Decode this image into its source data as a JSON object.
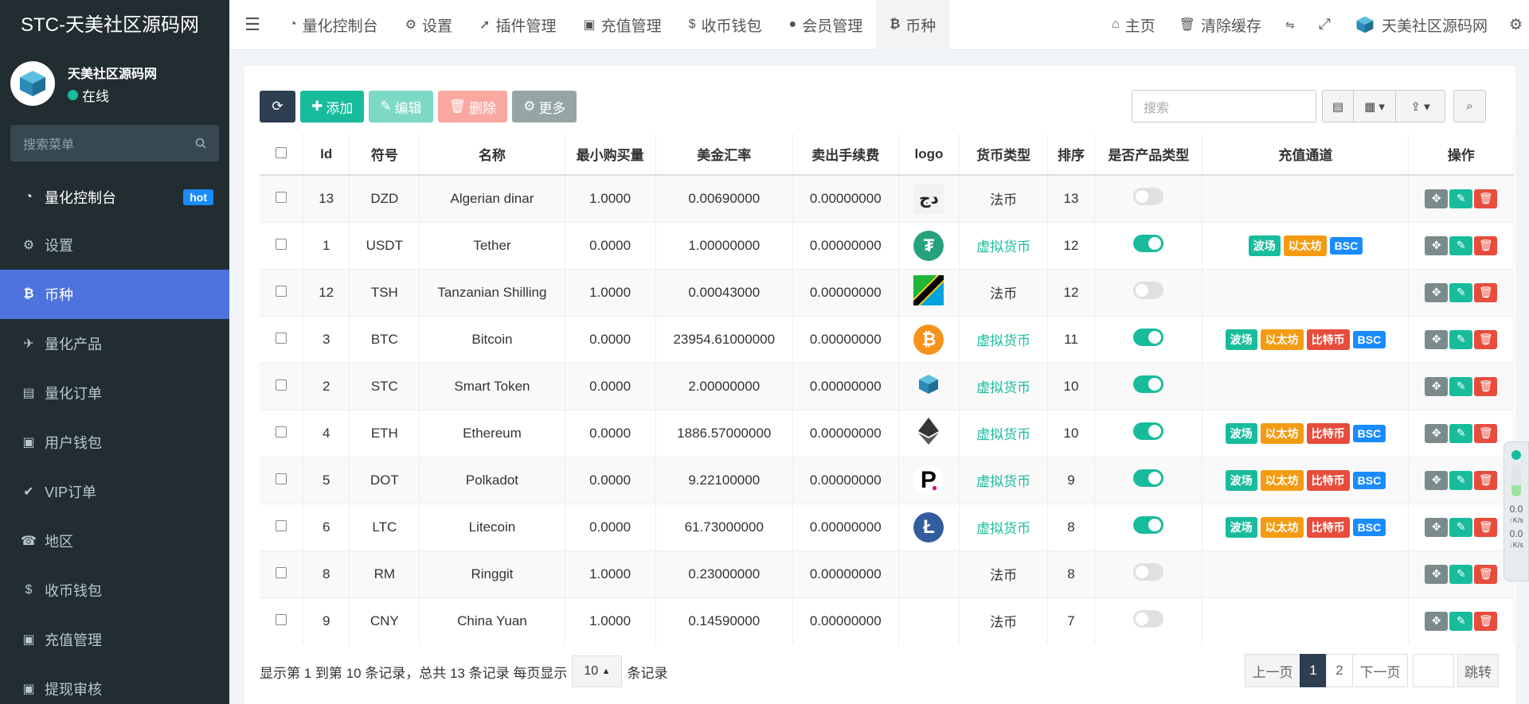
{
  "app": {
    "title": "STC-天美社区源码网"
  },
  "user": {
    "name": "天美社区源码网",
    "status": "在线"
  },
  "sidebar": {
    "search_placeholder": "搜索菜单",
    "items": [
      {
        "label": "量化控制台",
        "badge": "hot",
        "icon": "dashboard-icon"
      },
      {
        "label": "设置",
        "icon": "gear-icon"
      },
      {
        "label": "币种",
        "icon": "bitcoin-icon"
      },
      {
        "label": "量化产品",
        "icon": "plane-icon"
      },
      {
        "label": "量化订单",
        "icon": "book-icon"
      },
      {
        "label": "用户钱包",
        "icon": "money-icon"
      },
      {
        "label": "VIP订单",
        "icon": "check-circle-icon"
      },
      {
        "label": "地区",
        "icon": "phone-icon"
      },
      {
        "label": "收币钱包",
        "icon": "dollar-icon"
      },
      {
        "label": "充值管理",
        "icon": "money-icon"
      },
      {
        "label": "提现审核",
        "icon": "money-icon"
      }
    ]
  },
  "topbar": {
    "tabs": [
      {
        "label": "量化控制台",
        "icon": "dashboard-icon"
      },
      {
        "label": "设置",
        "icon": "gear-icon"
      },
      {
        "label": "插件管理",
        "icon": "rocket-icon"
      },
      {
        "label": "充值管理",
        "icon": "money-icon"
      },
      {
        "label": "收币钱包",
        "icon": "dollar-icon"
      },
      {
        "label": "会员管理",
        "icon": "user-icon"
      },
      {
        "label": "币种",
        "icon": "bitcoin-icon"
      }
    ],
    "home": "主页",
    "clear_cache": "清除缓存",
    "site_name": "天美社区源码网"
  },
  "toolbar": {
    "add": "添加",
    "edit": "编辑",
    "delete": "删除",
    "more": "更多",
    "search_placeholder": "搜索"
  },
  "table": {
    "headers": [
      "Id",
      "符号",
      "名称",
      "最小购买量",
      "美金汇率",
      "卖出手续费",
      "logo",
      "货币类型",
      "排序",
      "是否产品类型",
      "充值通道",
      "操作"
    ],
    "rows": [
      {
        "id": "13",
        "symbol": "DZD",
        "name": "Algerian dinar",
        "min": "1.0000",
        "rate": "0.00690000",
        "fee": "0.00000000",
        "logo": "dzd",
        "type": "法币",
        "sort": "13",
        "product": false,
        "channels": []
      },
      {
        "id": "1",
        "symbol": "USDT",
        "name": "Tether",
        "min": "0.0000",
        "rate": "1.00000000",
        "fee": "0.00000000",
        "logo": "usdt",
        "type": "虚拟货币",
        "sort": "12",
        "product": true,
        "channels": [
          "波场",
          "以太坊",
          "BSC"
        ]
      },
      {
        "id": "12",
        "symbol": "TSH",
        "name": "Tanzanian Shilling",
        "min": "1.0000",
        "rate": "0.00043000",
        "fee": "0.00000000",
        "logo": "tsh",
        "type": "法币",
        "sort": "12",
        "product": false,
        "channels": []
      },
      {
        "id": "3",
        "symbol": "BTC",
        "name": "Bitcoin",
        "min": "0.0000",
        "rate": "23954.61000000",
        "fee": "0.00000000",
        "logo": "btc",
        "type": "虚拟货币",
        "sort": "11",
        "product": true,
        "channels": [
          "波场",
          "以太坊",
          "比特币",
          "BSC"
        ]
      },
      {
        "id": "2",
        "symbol": "STC",
        "name": "Smart Token",
        "min": "0.0000",
        "rate": "2.00000000",
        "fee": "0.00000000",
        "logo": "stc",
        "type": "虚拟货币",
        "sort": "10",
        "product": true,
        "channels": []
      },
      {
        "id": "4",
        "symbol": "ETH",
        "name": "Ethereum",
        "min": "0.0000",
        "rate": "1886.57000000",
        "fee": "0.00000000",
        "logo": "eth",
        "type": "虚拟货币",
        "sort": "10",
        "product": true,
        "channels": [
          "波场",
          "以太坊",
          "比特币",
          "BSC"
        ]
      },
      {
        "id": "5",
        "symbol": "DOT",
        "name": "Polkadot",
        "min": "0.0000",
        "rate": "9.22100000",
        "fee": "0.00000000",
        "logo": "dot",
        "type": "虚拟货币",
        "sort": "9",
        "product": true,
        "channels": [
          "波场",
          "以太坊",
          "比特币",
          "BSC"
        ]
      },
      {
        "id": "6",
        "symbol": "LTC",
        "name": "Litecoin",
        "min": "0.0000",
        "rate": "61.73000000",
        "fee": "0.00000000",
        "logo": "ltc",
        "type": "虚拟货币",
        "sort": "8",
        "product": true,
        "channels": [
          "波场",
          "以太坊",
          "比特币",
          "BSC"
        ]
      },
      {
        "id": "8",
        "symbol": "RM",
        "name": "Ringgit",
        "min": "1.0000",
        "rate": "0.23000000",
        "fee": "0.00000000",
        "logo": "",
        "type": "法币",
        "sort": "8",
        "product": false,
        "channels": []
      },
      {
        "id": "9",
        "symbol": "CNY",
        "name": "China Yuan",
        "min": "1.0000",
        "rate": "0.14590000",
        "fee": "0.00000000",
        "logo": "",
        "type": "法币",
        "sort": "7",
        "product": false,
        "channels": []
      }
    ]
  },
  "footer": {
    "info_prefix": "显示第 1 到第 10 条记录，总共 13 条记录 每页显示",
    "page_size": "10",
    "info_suffix": "条记录",
    "prev": "上一页",
    "pages": [
      "1",
      "2"
    ],
    "next": "下一页",
    "jump": "跳转"
  },
  "widget": {
    "up": "0.0",
    "down": "0.0",
    "unit": "K/s"
  },
  "colors": {
    "sidebar": "#222d32",
    "accent": "#4e73df",
    "green": "#18bc9c",
    "orange": "#f39c12",
    "red": "#e74c3c",
    "blue": "#1a8cff"
  }
}
